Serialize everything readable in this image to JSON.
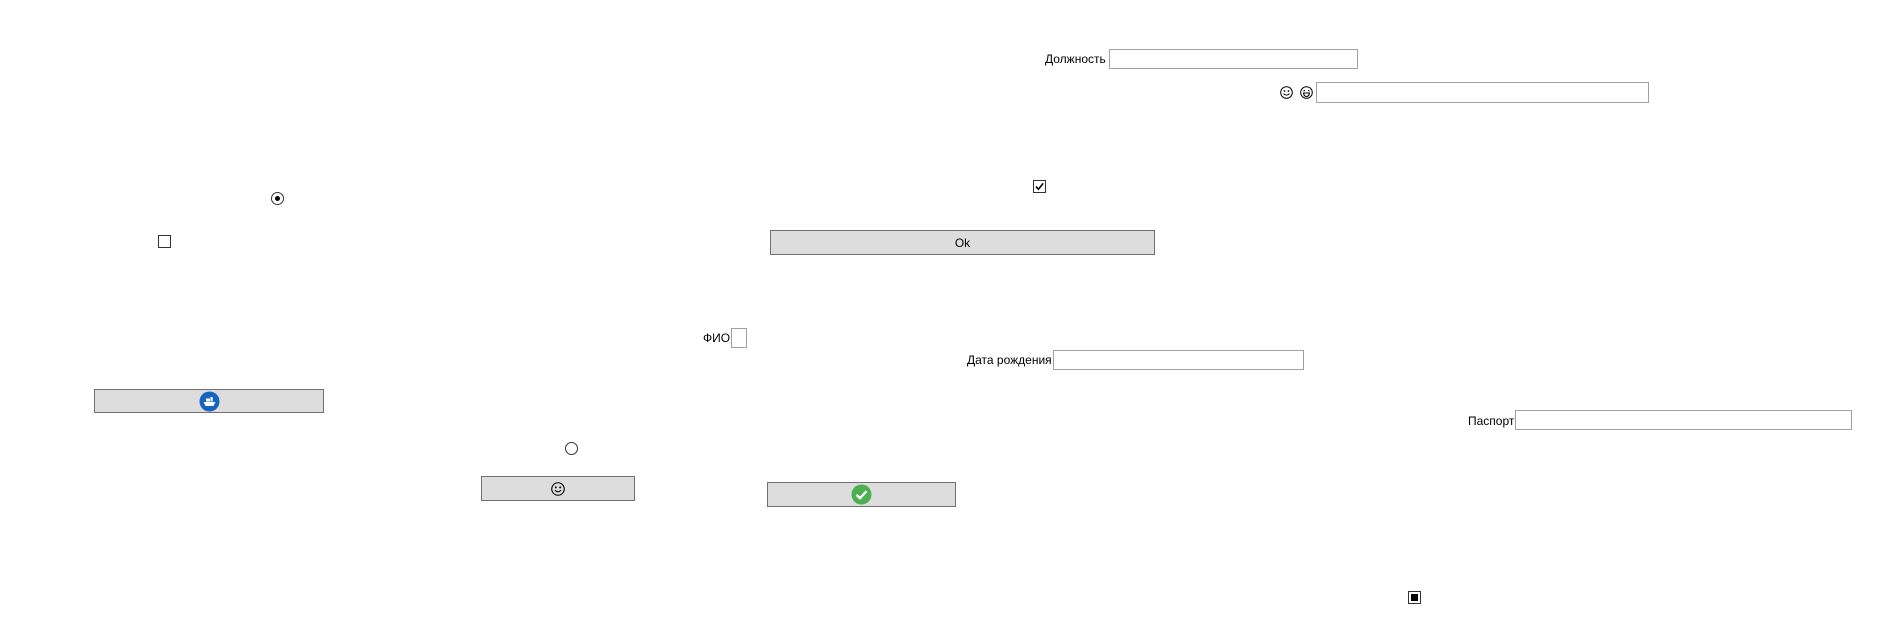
{
  "fields": {
    "position_label": "Должность",
    "position_value": "",
    "emoji_field_value": "",
    "fio_label": "ФИО",
    "fio_value": "",
    "birthdate_label": "Дата рождения",
    "birthdate_value": "",
    "passport_label": "Паспорт",
    "passport_value": ""
  },
  "buttons": {
    "ok_label": "Ok",
    "ship_icon": "ship-icon",
    "smiley_icon": "smiley-icon",
    "check_icon": "green-check-icon"
  },
  "icons": {
    "emoji_left": "smiley-icon",
    "emoji_right": "laughing-icon"
  },
  "controls": {
    "radio_top_checked": true,
    "radio_bottom_checked": false,
    "checkbox_left_checked": false,
    "checkbox_top_checked": true,
    "checkbox_bottom_indeterminate": true
  },
  "colors": {
    "button_bg": "#dddddd",
    "ship_blue": "#1565c0",
    "check_green": "#4caf50"
  }
}
